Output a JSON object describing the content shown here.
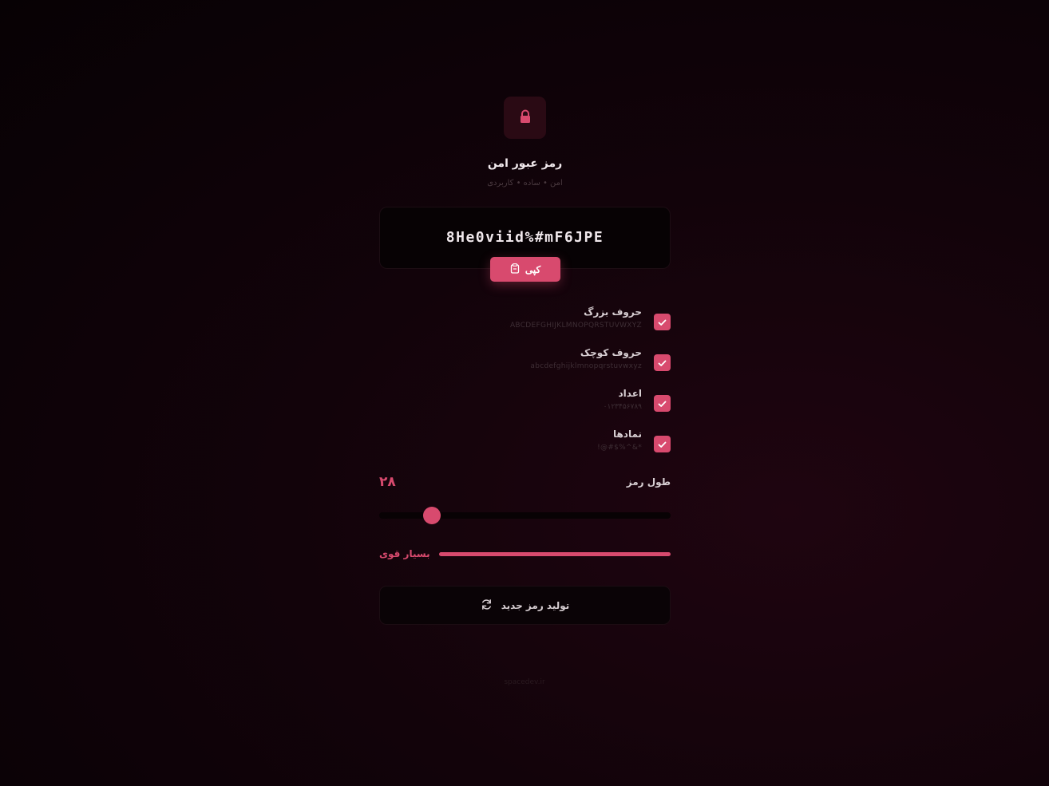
{
  "header": {
    "icon": "lock-icon",
    "title": "رمز عبور امن",
    "subtitle": "امن • ساده • کاربردی"
  },
  "password": {
    "value": "8He0viid%#mF6JPE",
    "copy_label": "کپی",
    "copy_icon": "clipboard-icon"
  },
  "options": [
    {
      "label": "حروف بزرگ",
      "sample": "ABCDEFGHIJKLMNOPQRSTUVWXYZ",
      "checked": true
    },
    {
      "label": "حروف کوچک",
      "sample": "abcdefghijklmnopqrstuvwxyz",
      "checked": true
    },
    {
      "label": "اعداد",
      "sample": "۰۱۲۳۴۵۶۷۸۹",
      "checked": true
    },
    {
      "label": "نمادها",
      "sample": "!@#$%^&*",
      "checked": true
    }
  ],
  "length": {
    "label": "طول رمز",
    "value": "۲۸",
    "slider_fraction": 0.18
  },
  "strength": {
    "label": "بسیار قوی",
    "fraction": 1.0
  },
  "generate": {
    "label": "تولید رمز جدید",
    "icon": "refresh-icon"
  },
  "footer": {
    "text": "spacedev.ir"
  },
  "colors": {
    "accent": "#d84a6e",
    "background": "#0d0207"
  }
}
